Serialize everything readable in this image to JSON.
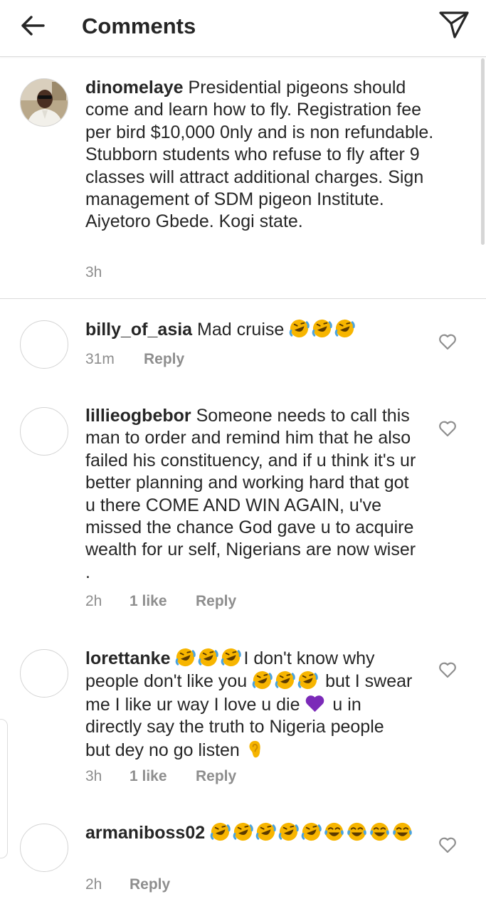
{
  "header": {
    "title": "Comments",
    "back_icon": "arrow-left-icon",
    "share_icon": "paper-plane-icon"
  },
  "caption": {
    "username": "dinomelaye",
    "text": "Presidential pigeons should come and learn how to fly. Registration fee per bird $10,000 0nly and is non refundable. Stubborn students who refuse to fly after 9 classes will attract additional charges. Sign management of SDM pigeon Institute. Aiyetoro Gbede. Kogi state.",
    "time": "3h"
  },
  "comments": [
    {
      "username": "billy_of_asia",
      "text": "Mad cruise",
      "emoji_after": [
        "rolling-laughing",
        "rolling-laughing",
        "rolling-laughing"
      ],
      "time": "31m",
      "likes": "",
      "reply": "Reply"
    },
    {
      "username": "lillieogbebor",
      "text": "Someone needs to call this man to order and remind him that he also failed his constituency, and if u think it's ur better planning and working hard that got u there COME AND WIN AGAIN, u've missed the chance God gave u to acquire wealth for ur self, Nigerians are now wiser .",
      "time": "2h",
      "likes": "1 like",
      "reply": "Reply"
    },
    {
      "username": "lorettanke",
      "text_1": "I don't know why people don't like you",
      "text_2": "but I swear me I like ur way I love u die",
      "text_3": "u in directly say the truth to Nigeria people but dey no go listen",
      "time": "3h",
      "likes": "1 like",
      "reply": "Reply"
    },
    {
      "username": "armaniboss02",
      "text": "",
      "emoji_after": [
        "rolling-laughing",
        "rolling-laughing",
        "rolling-laughing",
        "rolling-laughing",
        "rolling-laughing",
        "tears-of-joy",
        "tears-of-joy",
        "tears-of-joy",
        "tears-of-joy"
      ],
      "time": "2h",
      "likes": "",
      "reply": "Reply"
    }
  ],
  "colors": {
    "text": "#262626",
    "muted": "#8e8e8e",
    "divider": "#dbdbdb",
    "emoji_yellow": "#f7b500",
    "emoji_tear": "#4aa3df",
    "heart_purple": "#7b2ab8",
    "ear_yellow": "#f5b400"
  }
}
